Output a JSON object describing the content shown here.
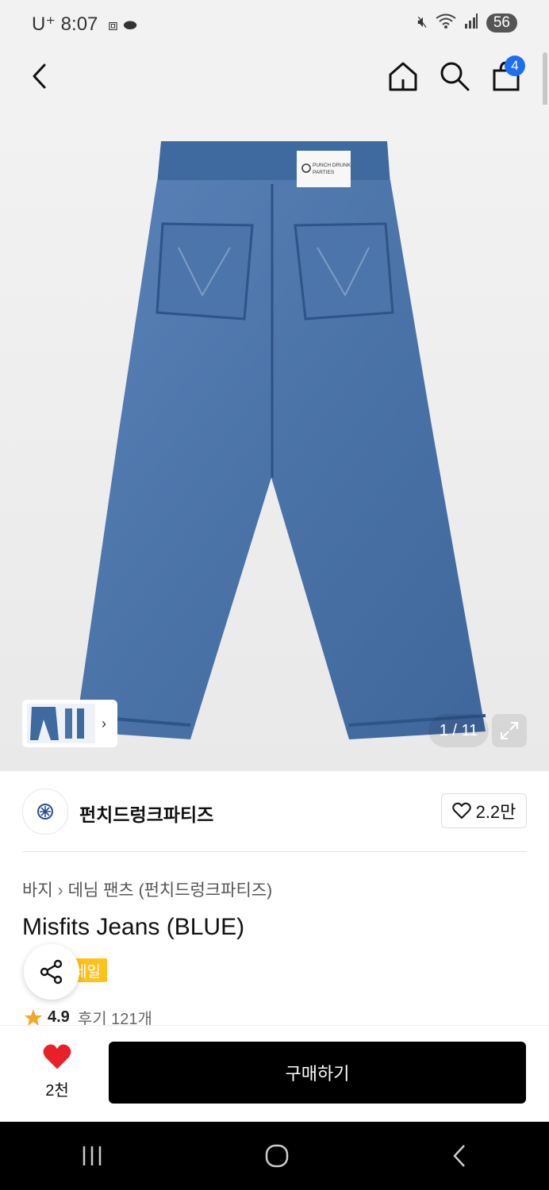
{
  "status_bar": {
    "carrier": "U⁺",
    "time": "8:07",
    "battery": "56"
  },
  "cart": {
    "count": "4"
  },
  "gallery": {
    "counter": "1 / 11",
    "jeans_label_line1": "PUNCH DRUNK",
    "jeans_label_line2": "PARTIES"
  },
  "brand": {
    "name": "펀치드렁크파티즈",
    "likes": "2.2만"
  },
  "breadcrumb": {
    "level1": "바지",
    "level2": "데님 팬츠 (펀치드렁크파티즈)"
  },
  "product": {
    "title": "Misfits Jeans (BLUE)",
    "sale_badge": "세일"
  },
  "rating": {
    "score": "4.9",
    "reviews": "후기 121개"
  },
  "buy_bar": {
    "wish_count": "2천",
    "buy_label": "구매하기"
  },
  "colors": {
    "accent_blue": "#1e6ef0",
    "heart_red": "#e8202a",
    "sale_yellow": "#ffc21a",
    "star": "#f5a623",
    "denim": "#4a73a8"
  }
}
